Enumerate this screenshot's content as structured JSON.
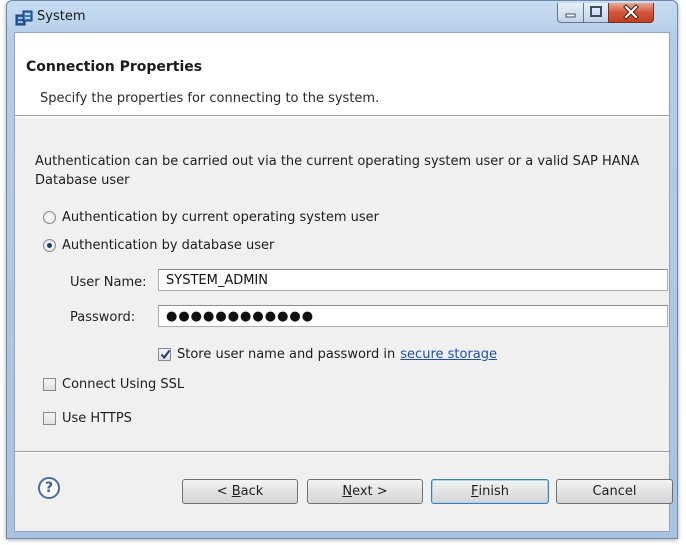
{
  "window": {
    "title": "System"
  },
  "header": {
    "title": "Connection Properties",
    "description": "Specify the properties for connecting to the system."
  },
  "body": {
    "intro": "Authentication can be carried out via the current operating system user or a valid SAP HANA Database user",
    "auth_options": [
      {
        "label": "Authentication by current operating system user",
        "selected": false
      },
      {
        "label": "Authentication by database user",
        "selected": true
      }
    ],
    "user_name": {
      "label": "User Name:",
      "value": "SYSTEM_ADMIN"
    },
    "password": {
      "label": "Password:",
      "value": "●●●●●●●●●●●●"
    },
    "store_credentials": {
      "label": "Store user name and password in",
      "link": "secure storage",
      "checked": true
    },
    "connect_ssl": {
      "label": "Connect Using SSL",
      "checked": false
    },
    "use_https": {
      "label": "Use HTTPS",
      "checked": false
    }
  },
  "footer": {
    "help_symbol": "?",
    "back": {
      "prefix": "< ",
      "accel": "B",
      "rest": "ack"
    },
    "next": {
      "accel": "N",
      "rest": "ext >"
    },
    "finish": {
      "accel": "F",
      "rest": "inish"
    },
    "cancel": "Cancel"
  },
  "colors": {
    "link": "#1b4fb3",
    "selected_radio": "#1c3f70",
    "default_button_border": "#3c7fb1"
  }
}
